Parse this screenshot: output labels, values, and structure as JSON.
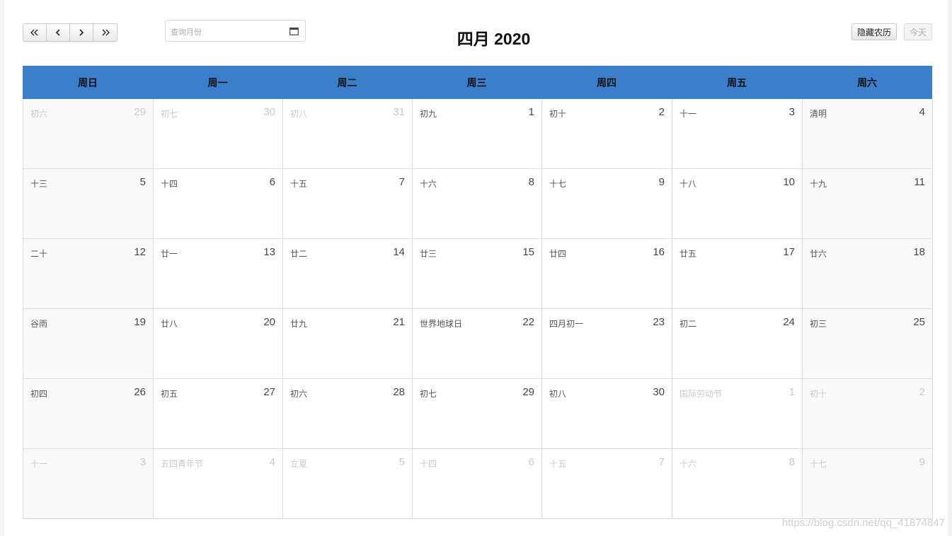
{
  "toolbar": {
    "nav": [
      {
        "icon": "double-chevron-left-icon",
        "glyph": "«"
      },
      {
        "icon": "chevron-left-icon",
        "glyph": "‹"
      },
      {
        "icon": "chevron-right-icon",
        "glyph": "›"
      },
      {
        "icon": "double-chevron-right-icon",
        "glyph": "»"
      }
    ],
    "month_input_placeholder": "查询月份",
    "title": "四月 2020",
    "hide_lunar_label": "隐藏农历",
    "today_label": "今天"
  },
  "weekdays": [
    "周日",
    "周一",
    "周二",
    "周三",
    "周四",
    "周五",
    "周六"
  ],
  "weeks": [
    [
      {
        "day": "29",
        "lunar": "初六",
        "other": true
      },
      {
        "day": "30",
        "lunar": "初七",
        "other": true
      },
      {
        "day": "31",
        "lunar": "初八",
        "other": true
      },
      {
        "day": "1",
        "lunar": "初九",
        "other": false
      },
      {
        "day": "2",
        "lunar": "初十",
        "other": false
      },
      {
        "day": "3",
        "lunar": "十一",
        "other": false
      },
      {
        "day": "4",
        "lunar": "清明",
        "other": false
      }
    ],
    [
      {
        "day": "5",
        "lunar": "十三",
        "other": false
      },
      {
        "day": "6",
        "lunar": "十四",
        "other": false
      },
      {
        "day": "7",
        "lunar": "十五",
        "other": false
      },
      {
        "day": "8",
        "lunar": "十六",
        "other": false
      },
      {
        "day": "9",
        "lunar": "十七",
        "other": false
      },
      {
        "day": "10",
        "lunar": "十八",
        "other": false
      },
      {
        "day": "11",
        "lunar": "十九",
        "other": false
      }
    ],
    [
      {
        "day": "12",
        "lunar": "二十",
        "other": false
      },
      {
        "day": "13",
        "lunar": "廿一",
        "other": false
      },
      {
        "day": "14",
        "lunar": "廿二",
        "other": false
      },
      {
        "day": "15",
        "lunar": "廿三",
        "other": false
      },
      {
        "day": "16",
        "lunar": "廿四",
        "other": false
      },
      {
        "day": "17",
        "lunar": "廿五",
        "other": false
      },
      {
        "day": "18",
        "lunar": "廿六",
        "other": false
      }
    ],
    [
      {
        "day": "19",
        "lunar": "谷雨",
        "other": false
      },
      {
        "day": "20",
        "lunar": "廿八",
        "other": false
      },
      {
        "day": "21",
        "lunar": "廿九",
        "other": false
      },
      {
        "day": "22",
        "lunar": "世界地球日",
        "other": false
      },
      {
        "day": "23",
        "lunar": "四月初一",
        "other": false
      },
      {
        "day": "24",
        "lunar": "初二",
        "other": false
      },
      {
        "day": "25",
        "lunar": "初三",
        "other": false
      }
    ],
    [
      {
        "day": "26",
        "lunar": "初四",
        "other": false
      },
      {
        "day": "27",
        "lunar": "初五",
        "other": false
      },
      {
        "day": "28",
        "lunar": "初六",
        "other": false
      },
      {
        "day": "29",
        "lunar": "初七",
        "other": false
      },
      {
        "day": "30",
        "lunar": "初八",
        "other": false
      },
      {
        "day": "1",
        "lunar": "国际劳动节",
        "other": true
      },
      {
        "day": "2",
        "lunar": "初十",
        "other": true
      }
    ],
    [
      {
        "day": "3",
        "lunar": "十一",
        "other": true
      },
      {
        "day": "4",
        "lunar": "五四青年节",
        "other": true
      },
      {
        "day": "5",
        "lunar": "立夏",
        "other": true
      },
      {
        "day": "6",
        "lunar": "十四",
        "other": true
      },
      {
        "day": "7",
        "lunar": "十五",
        "other": true
      },
      {
        "day": "8",
        "lunar": "十六",
        "other": true
      },
      {
        "day": "9",
        "lunar": "十七",
        "other": true
      }
    ]
  ],
  "colors": {
    "header_bg": "#3b7fcb",
    "weekend_bg": "#f8f9fb",
    "other_month_text": "#c8c8c8"
  },
  "watermark": "https://blog.csdn.net/qq_41874847"
}
